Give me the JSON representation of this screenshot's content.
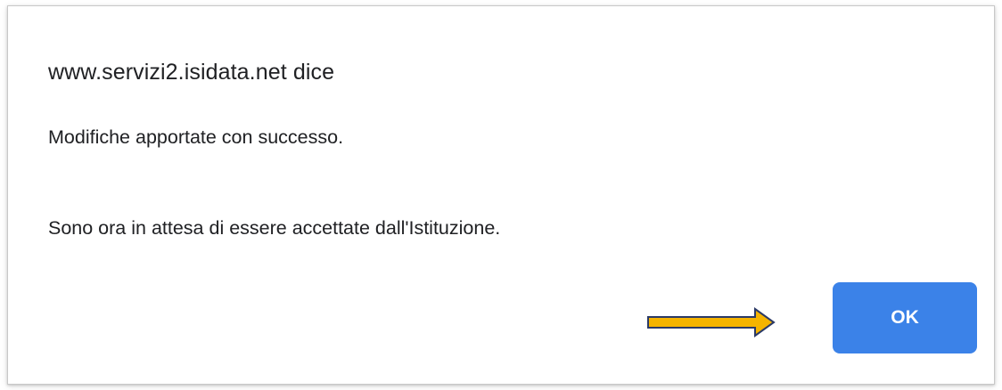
{
  "dialog": {
    "title": "www.servizi2.isidata.net dice",
    "message_line1": "Modifiche apportate con successo.",
    "message_line2": "Sono ora in attesa di essere accettate dall'Istituzione.",
    "ok_label": "OK"
  },
  "annotation": {
    "icon": "arrow-right-icon",
    "fill_color": "#f5b400",
    "stroke_color": "#2b3a67"
  },
  "colors": {
    "button_bg": "#3b82e8",
    "button_text": "#ffffff",
    "text": "#202124"
  }
}
